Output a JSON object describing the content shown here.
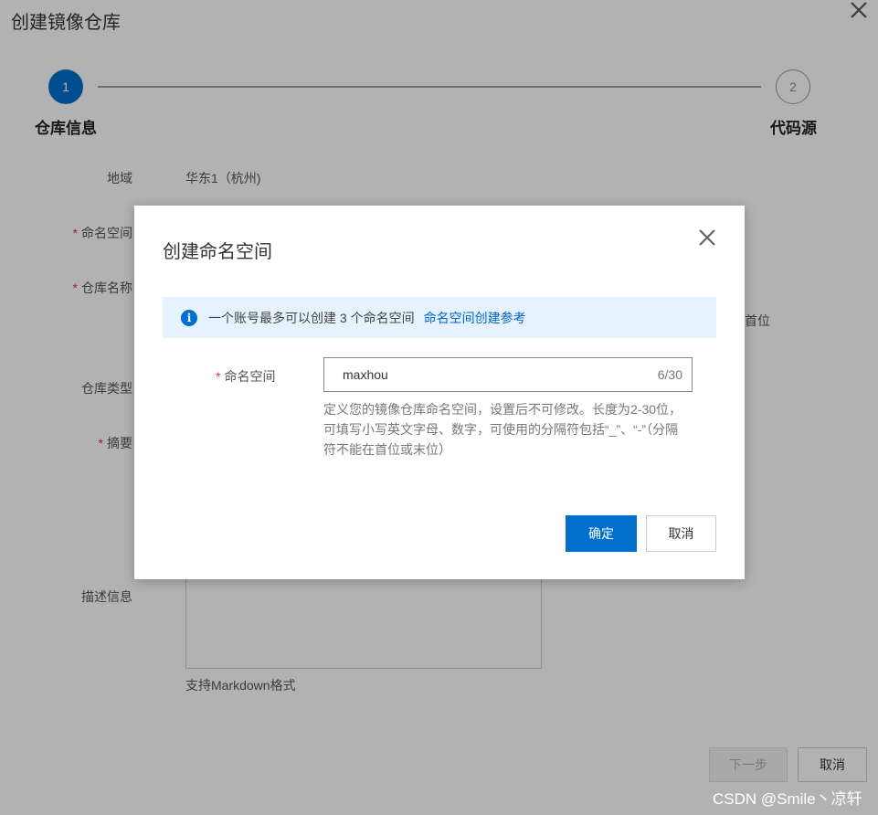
{
  "page": {
    "title": "创建镜像仓库",
    "steps": [
      {
        "number": "1",
        "label": "仓库信息"
      },
      {
        "number": "2",
        "label": "代码源"
      }
    ],
    "form": {
      "region_label": "地域",
      "region_value": "华东1（杭州)",
      "namespace_label": "命名空间",
      "repo_name_label": "仓库名称",
      "repo_type_label": "仓库类型",
      "summary_label": "摘要",
      "description_label": "描述信息",
      "markdown_note": "支持Markdown格式",
      "partial_hint": "首位",
      "required_mark": "*"
    },
    "buttons": {
      "next": "下一步",
      "cancel": "取消"
    }
  },
  "modal": {
    "title": "创建命名空间",
    "info": {
      "text": "一个账号最多可以创建 3 个命名空间",
      "link": "命名空间创建参考"
    },
    "field": {
      "required_mark": "*",
      "label": "命名空间",
      "value": "maxhou",
      "counter": "6/30",
      "help": "定义您的镜像仓库命名空间，设置后不可修改。长度为2-30位，可填写小写英文字母、数字，可使用的分隔符包括“_”、“-”（分隔符不能在首位或末位）"
    },
    "buttons": {
      "ok": "确定",
      "cancel": "取消"
    }
  },
  "watermark": "CSDN @Smile丶凉轩",
  "icons": {
    "page_close": "close-icon",
    "modal_close": "close-icon",
    "info": "info-icon"
  },
  "colors": {
    "primary": "#0070cc",
    "info_bg": "#e6f3fe",
    "required": "#e23030",
    "link": "#0064c8"
  }
}
